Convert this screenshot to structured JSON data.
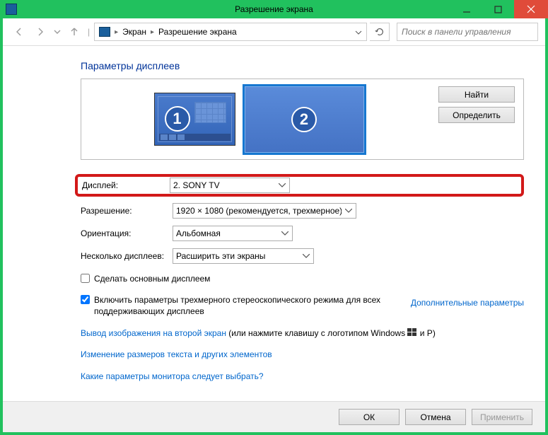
{
  "window": {
    "title": "Разрешение экрана",
    "close": "Закрыть",
    "maximize": "Развернуть",
    "minimize": "Свернуть"
  },
  "nav": {
    "back": "Назад",
    "forward": "Вперед",
    "up": "Вверх",
    "crumb1": "Экран",
    "crumb2": "Разрешение экрана",
    "search_placeholder": "Поиск в панели управления"
  },
  "section": {
    "title": "Параметры дисплеев",
    "detect": "Найти",
    "identify": "Определить",
    "mon1": "1",
    "mon2": "2"
  },
  "form": {
    "display_label": "Дисплей:",
    "display_value": "2. SONY TV",
    "resolution_label": "Разрешение:",
    "resolution_value": "1920 × 1080 (рекомендуется, трехмерное)",
    "orientation_label": "Ориентация:",
    "orientation_value": "Альбомная",
    "multiple_label": "Несколько дисплеев:",
    "multiple_value": "Расширить эти экраны"
  },
  "checks": {
    "primary": "Сделать основным дисплеем",
    "stereo": "Включить параметры трехмерного стереоскопического режима для всех поддерживающих дисплеев"
  },
  "links": {
    "advanced": "Дополнительные параметры",
    "project_link": "Вывод изображения на второй экран",
    "project_rest": " (или нажмите клавишу с логотипом Windows ",
    "project_suffix": " и P)",
    "text_size": "Изменение размеров текста и других элементов",
    "help": "Какие параметры монитора следует выбрать?"
  },
  "footer": {
    "ok": "ОК",
    "cancel": "Отмена",
    "apply": "Применить"
  }
}
